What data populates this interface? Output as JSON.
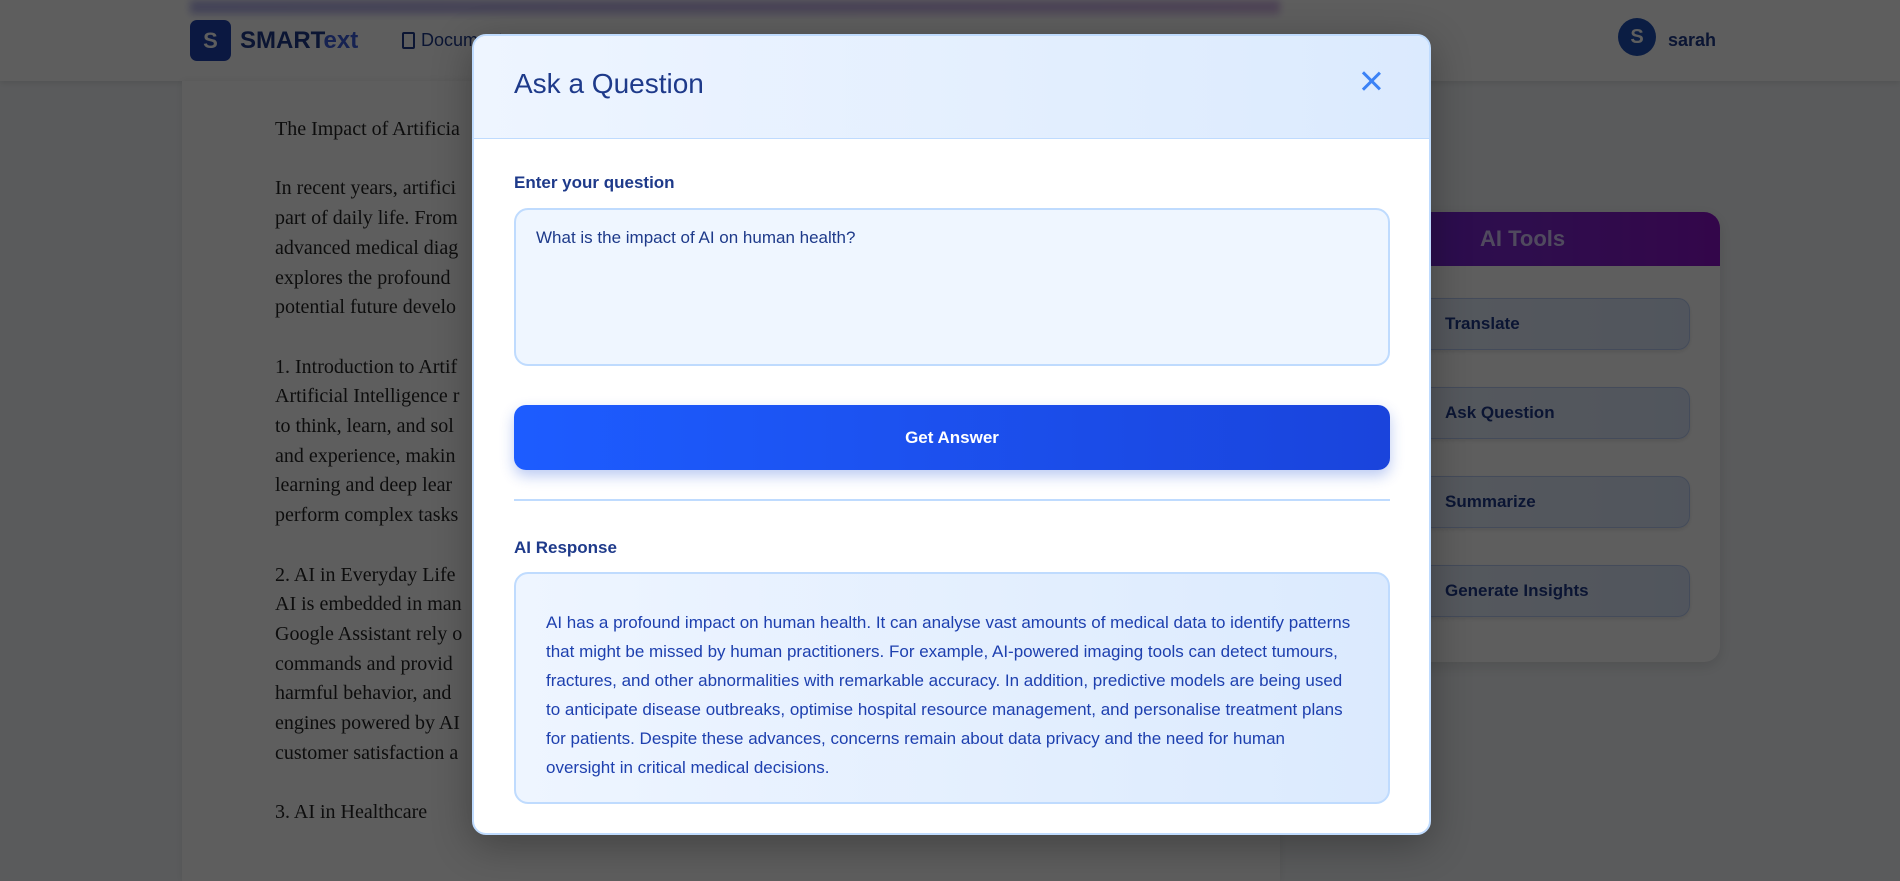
{
  "header": {
    "logo_letter": "S",
    "brand_main": "SMART",
    "brand_accent": "ext",
    "nav_documents": "Documents",
    "user_initial": "S",
    "user_name": "sarah"
  },
  "document": {
    "lines": [
      "The Impact of Artificia",
      "",
      "In recent years, artifici",
      "part of daily life. From",
      "advanced medical diag",
      "explores the profound",
      "potential future develo",
      "",
      "1. Introduction to Artif",
      "Artificial Intelligence r",
      "to think, learn, and sol",
      "and experience, makin",
      "learning and deep lear",
      "perform complex tasks",
      "",
      "2. AI in Everyday Life",
      "AI is embedded in man",
      "Google Assistant rely o",
      "commands and provid",
      "harmful behavior, and",
      "engines powered by AI",
      "customer satisfaction a",
      "",
      "3. AI in Healthcare"
    ]
  },
  "ai_tools": {
    "title": "AI Tools",
    "items": [
      "Translate",
      "Ask Question",
      "Summarize",
      "Generate Insights"
    ]
  },
  "modal": {
    "title": "Ask a Question",
    "question_label": "Enter your question",
    "question_value": "What is the impact of AI on human health?",
    "button": "Get Answer",
    "response_label": "AI Response",
    "response": "AI has a profound impact on human health. It can analyse vast amounts of medical data to identify patterns that might be missed by human practitioners. For example, AI-powered imaging tools can detect tumours, fractures, and other abnormalities with remarkable accuracy. In addition, predictive models are being used to anticipate disease outbreaks, optimise hospital resource management, and personalise treatment plans for patients. Despite these advances, concerns remain about data privacy and the need for human oversight in critical medical decisions."
  }
}
